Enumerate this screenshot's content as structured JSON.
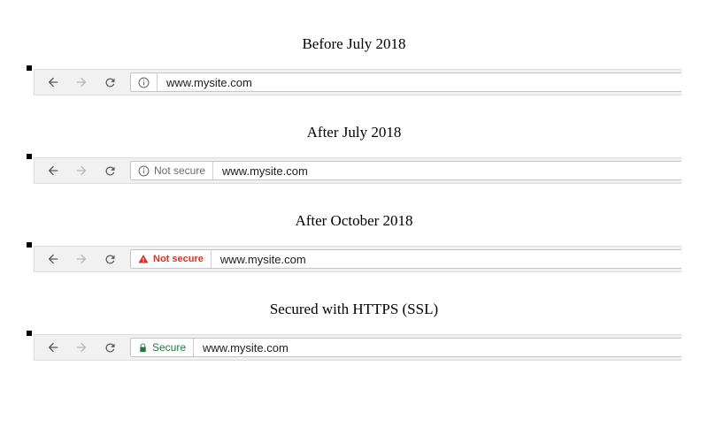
{
  "sections": [
    {
      "caption": "Before July 2018",
      "status": {
        "variant": "info-only",
        "label": ""
      },
      "url": "www.mysite.com"
    },
    {
      "caption": "After July 2018",
      "status": {
        "variant": "gray",
        "label": "Not secure"
      },
      "url": "www.mysite.com"
    },
    {
      "caption": "After October 2018",
      "status": {
        "variant": "red",
        "label": "Not secure"
      },
      "url": "www.mysite.com"
    },
    {
      "caption": "Secured with HTTPS (SSL)",
      "status": {
        "variant": "green",
        "label": "Secure"
      },
      "url": "www.mysite.com"
    }
  ]
}
